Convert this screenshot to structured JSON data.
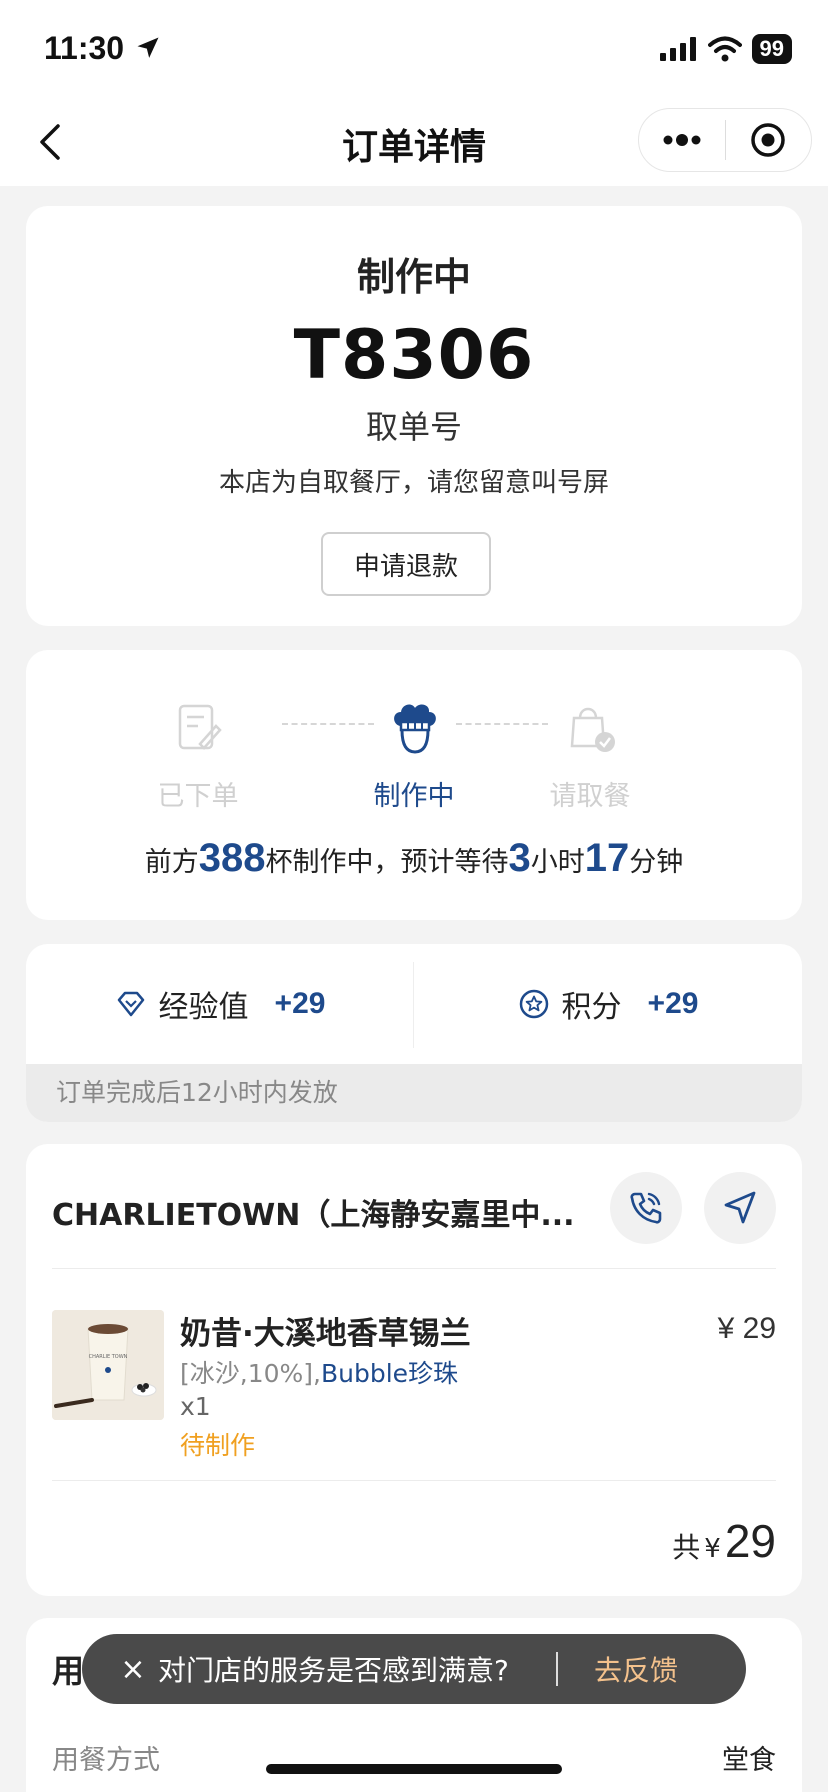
{
  "status_bar": {
    "time": "11:30",
    "battery": "99"
  },
  "nav": {
    "title": "订单详情"
  },
  "order": {
    "status": "制作中",
    "pickup_code": "T8306",
    "pickup_code_label": "取单号",
    "note": "本店为自取餐厅，请您留意叫号屏",
    "refund_button": "申请退款"
  },
  "progress": {
    "steps": [
      {
        "label": "已下单",
        "state": "done"
      },
      {
        "label": "制作中",
        "state": "active"
      },
      {
        "label": "请取餐",
        "state": "pending"
      }
    ],
    "wait": {
      "prefix": "前方",
      "cups": "388",
      "mid": "杯制作中，预计等待",
      "hours": "3",
      "hours_unit": "小时",
      "minutes": "17",
      "minutes_unit": "分钟"
    }
  },
  "rewards": {
    "exp_label": "经验值",
    "exp_value": "+29",
    "points_label": "积分",
    "points_value": "+29",
    "note": "订单完成后12小时内发放"
  },
  "store": {
    "name": "CHARLIETOWN（上海静安嘉里中..."
  },
  "item": {
    "name": "奶昔·大溪地香草锡兰",
    "options_plain": "[冰沙,10%],",
    "options_highlight": "Bubble珍珠",
    "qty": "x1",
    "state": "待制作",
    "price": "¥ 29",
    "image_text": "CHARLIE TOWN"
  },
  "total": {
    "label": "共",
    "currency": "¥",
    "value": "29"
  },
  "dining": {
    "title": "用餐信息",
    "method_label": "用餐方式",
    "method_value": "堂食"
  },
  "toast": {
    "close": "×",
    "text": "对门店的服务是否感到满意?",
    "action": "去反馈"
  },
  "colors": {
    "accent": "#1e4a8c",
    "pending": "#f0a020",
    "toast_link": "#f3c18c"
  }
}
